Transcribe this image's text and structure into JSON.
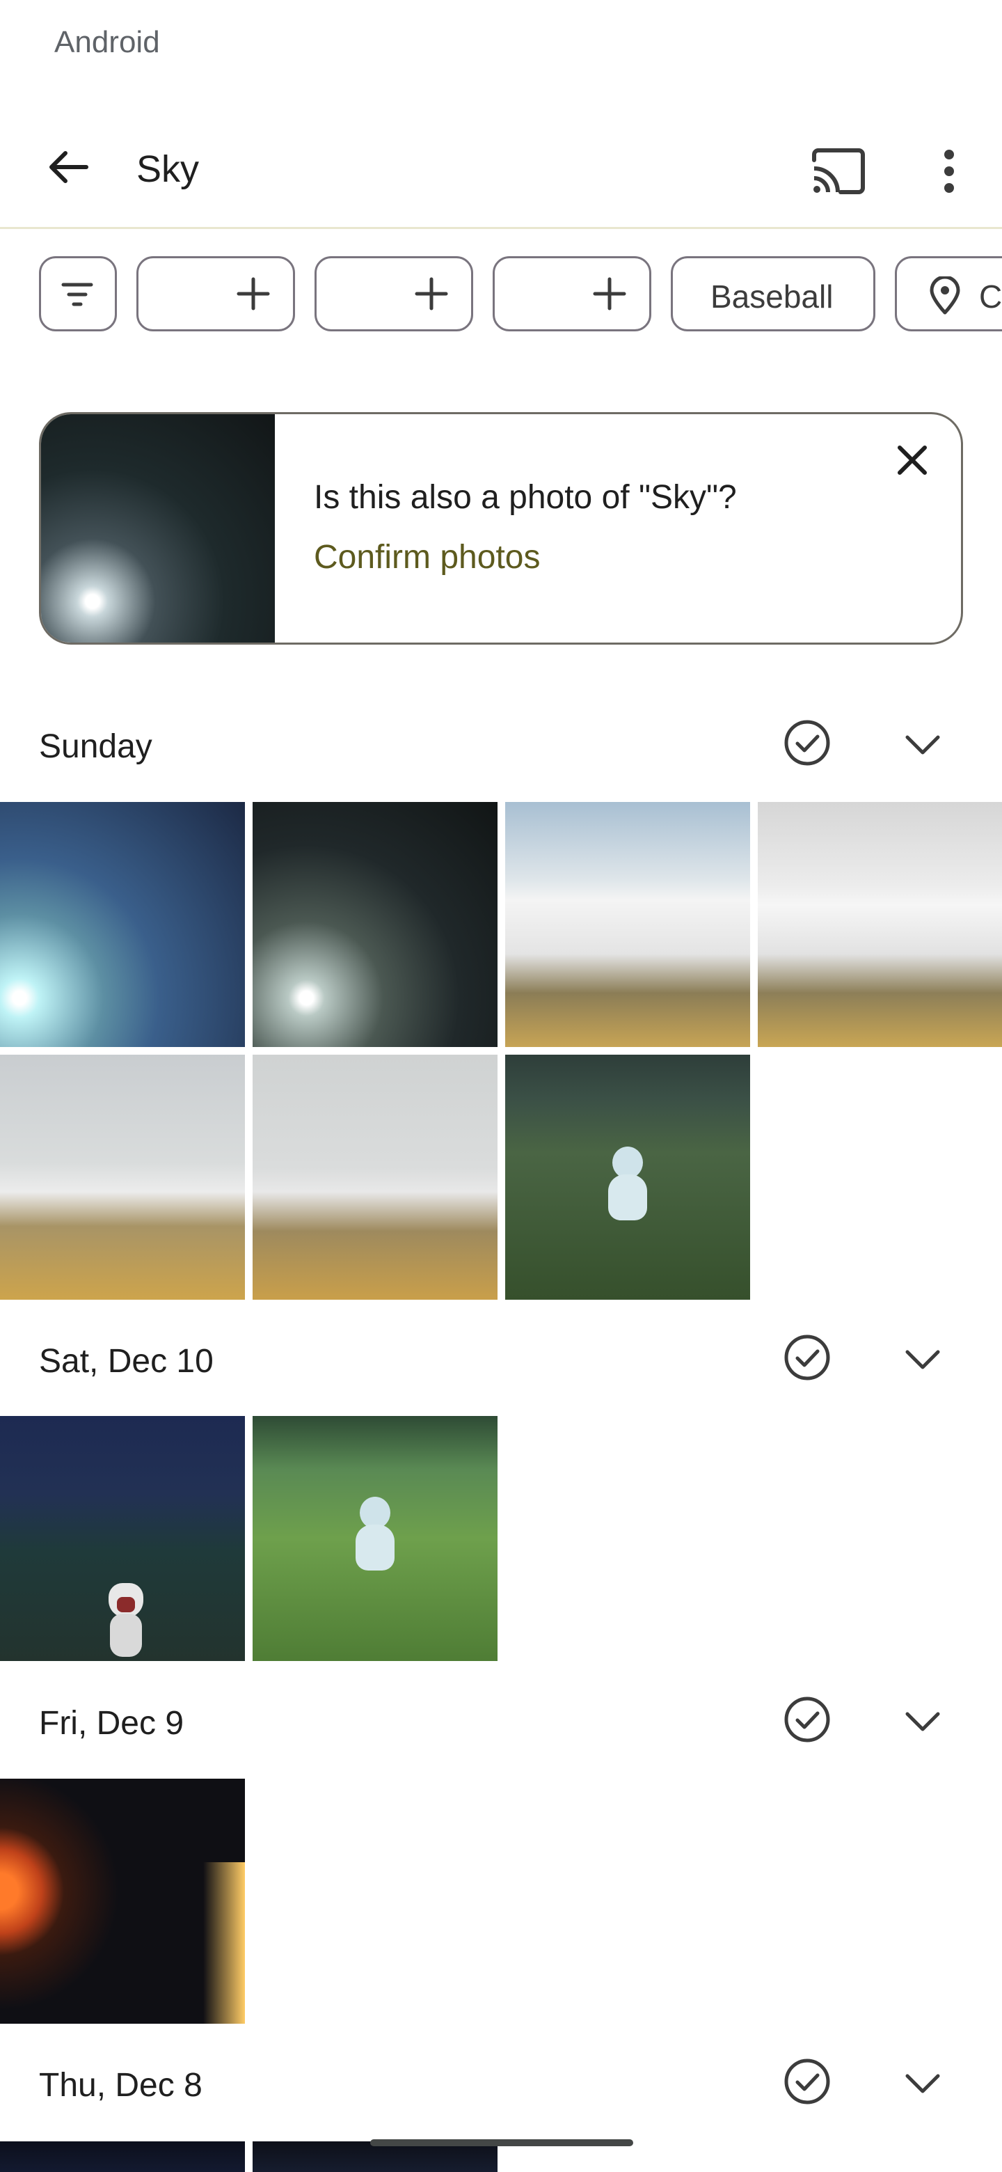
{
  "status_bar": {
    "text": "Android"
  },
  "app_bar": {
    "title": "Sky",
    "back_icon": "arrow-back-icon",
    "cast_icon": "cast-icon",
    "more_icon": "more-vert-icon"
  },
  "chips": [
    {
      "type": "filter",
      "icon": "filter-icon",
      "label": ""
    },
    {
      "type": "person",
      "icon": "plus-icon",
      "label": ""
    },
    {
      "type": "person",
      "icon": "plus-icon",
      "label": ""
    },
    {
      "type": "person",
      "icon": "plus-icon",
      "label": ""
    },
    {
      "type": "text",
      "label": "Baseball"
    },
    {
      "type": "location",
      "icon": "location-pin-icon",
      "label": "C"
    }
  ],
  "suggestion": {
    "question": "Is this also a photo of \"Sky\"?",
    "action": "Confirm photos",
    "close_icon": "close-icon"
  },
  "sections": [
    {
      "label": "Sunday",
      "photo_count": 7
    },
    {
      "label": "Sat, Dec 10",
      "photo_count": 2
    },
    {
      "label": "Fri, Dec 9",
      "photo_count": 1
    },
    {
      "label": "Thu, Dec 8",
      "photo_count": 2
    }
  ],
  "colors": {
    "accent_link": "#5d5a1e",
    "outline": "#79747e",
    "divider": "#e9e7cf"
  }
}
